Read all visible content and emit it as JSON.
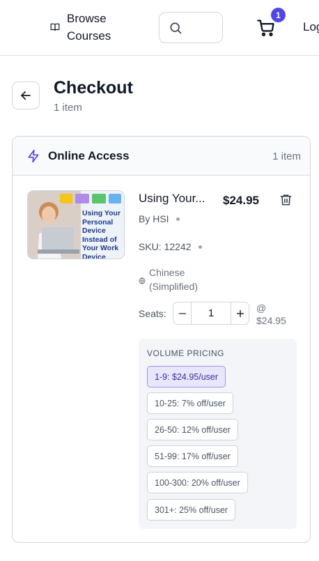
{
  "header": {
    "browse_label": "Browse Courses",
    "cart_count": "1",
    "login_label": "Log"
  },
  "page": {
    "title": "Checkout",
    "subtitle": "1 item"
  },
  "section": {
    "title": "Online Access",
    "count": "1 item"
  },
  "item": {
    "title": "Using Your...",
    "price": "$24.95",
    "by": "By HSI",
    "sku": "SKU: 12242",
    "language": "Chinese (Simplified)",
    "thumbnail_text": "Using Your Personal Device Instead of Your Work Device",
    "seats_label": "Seats:",
    "seats_value": "1",
    "unit_price": "@ $24.95"
  },
  "volume_pricing": {
    "title": "VOLUME PRICING",
    "tiers": [
      {
        "label": "1-9: $24.95/user",
        "active": true
      },
      {
        "label": "10-25: 7% off/user",
        "active": false
      },
      {
        "label": "26-50: 12% off/user",
        "active": false
      },
      {
        "label": "51-99: 17% off/user",
        "active": false
      },
      {
        "label": "100-300: 20% off/user",
        "active": false
      },
      {
        "label": "301+: 25% off/user",
        "active": false
      }
    ]
  },
  "colors": {
    "accent": "#4f46e5",
    "active_tier_bg": "#e7e6fc"
  },
  "icons": [
    "book-icon",
    "search-icon",
    "cart-icon",
    "arrow-left-icon",
    "bolt-icon",
    "trash-icon",
    "globe-icon",
    "minus-icon",
    "plus-icon"
  ]
}
